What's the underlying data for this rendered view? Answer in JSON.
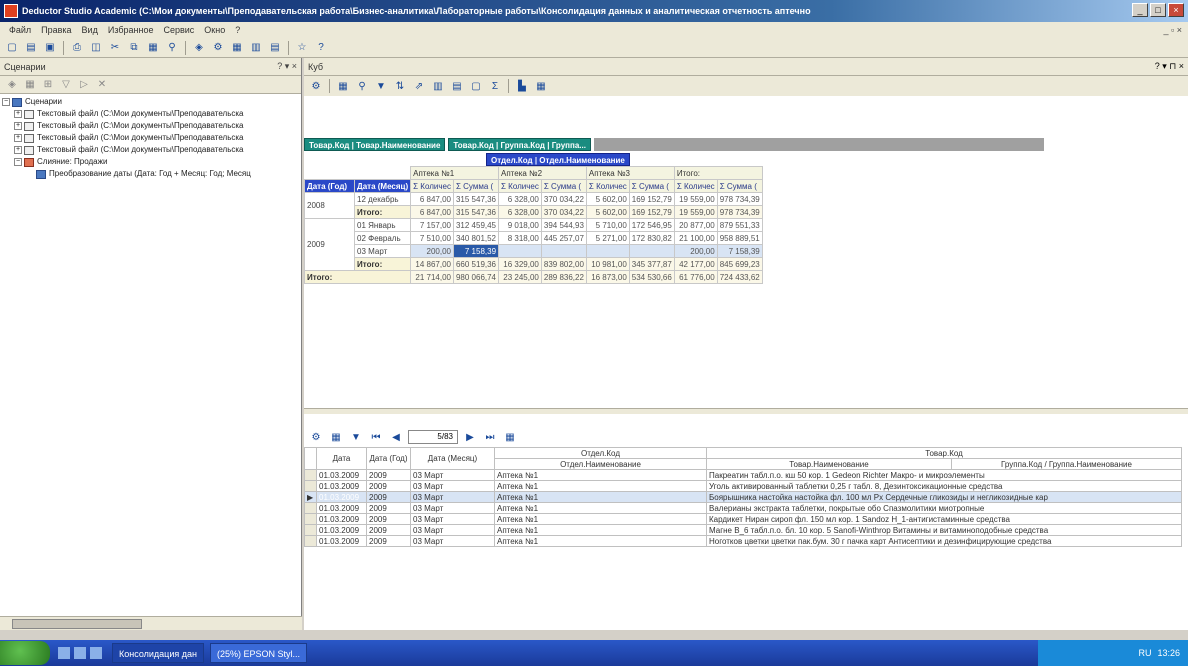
{
  "window": {
    "title": "Deductor Studio Academic (C:\\Мои документы\\Преподавательская работа\\Бизнес-аналитика\\Лабораторные работы\\Консолидация данных и аналитическая отчетность аптечно",
    "min": "_",
    "max": "□",
    "close": "×"
  },
  "menu": {
    "items": [
      "Файл",
      "Правка",
      "Вид",
      "Избранное",
      "Сервис",
      "Окно",
      "?"
    ],
    "mdi_controls": "_ ▫ ×"
  },
  "left_panel": {
    "title": "Сценарии",
    "controls": "? ▾ ×",
    "tree": [
      {
        "label": "Сценарии",
        "level": 0,
        "exp": "−",
        "icon": "folder"
      },
      {
        "label": "Текстовый файл (C:\\Мои документы\\Преподавательска",
        "level": 1,
        "exp": "+",
        "icon": "txt"
      },
      {
        "label": "Текстовый файл (C:\\Мои документы\\Преподавательска",
        "level": 1,
        "exp": "+",
        "icon": "txt"
      },
      {
        "label": "Текстовый файл (C:\\Мои документы\\Преподавательска",
        "level": 1,
        "exp": "+",
        "icon": "txt"
      },
      {
        "label": "Текстовый файл (C:\\Мои документы\\Преподавательска",
        "level": 1,
        "exp": "+",
        "icon": "txt"
      },
      {
        "label": "Слияние: Продажи",
        "level": 1,
        "exp": "−",
        "icon": "red"
      },
      {
        "label": "Преобразование даты (Дата: Год + Месяц: Год; Месяц",
        "level": 2,
        "exp": "",
        "icon": "folder"
      }
    ]
  },
  "right_panel": {
    "title": "Куб",
    "controls": "? ▾ ⊓ ×",
    "col_dims": [
      "Товар.Код | Товар.Наименование",
      "Товар.Код | Группа.Код | Группа..."
    ],
    "col_dim2": "Отдел.Код | Отдел.Наименование",
    "row_dims": [
      "Дата (Год)",
      "Дата (Месяц)"
    ],
    "departments": [
      "Аптека №1",
      "Аптека №2",
      "Аптека №3",
      "Итого:"
    ],
    "measures": [
      "Σ Количес",
      "Σ Сумма ("
    ],
    "rows": [
      {
        "year": "2008",
        "month": "12 декабрь",
        "vals": [
          "6 847,00",
          "315 547,36",
          "6 328,00",
          "370 034,22",
          "5 602,00",
          "169 152,79",
          "19 559,00",
          "978 734,39"
        ]
      },
      {
        "year": "",
        "month": "Итого:",
        "vals": [
          "6 847,00",
          "315 547,36",
          "6 328,00",
          "370 034,22",
          "5 602,00",
          "169 152,79",
          "19 559,00",
          "978 734,39"
        ],
        "total": true
      },
      {
        "year": "2009",
        "month": "01 Январь",
        "vals": [
          "7 157,00",
          "312 459,45",
          "9 018,00",
          "394 544,93",
          "5 710,00",
          "172 546,95",
          "20 877,00",
          "879 551,33"
        ]
      },
      {
        "year": "",
        "month": "02 Февраль",
        "vals": [
          "7 510,00",
          "340 801,52",
          "8 318,00",
          "445 257,07",
          "5 271,00",
          "172 830,82",
          "21 100,00",
          "958 889,51"
        ]
      },
      {
        "year": "",
        "month": "03 Март",
        "vals": [
          "200,00",
          "7 158,39",
          "",
          "",
          "",
          "",
          "200,00",
          "7 158,39"
        ],
        "selected": true
      },
      {
        "year": "",
        "month": "Итого:",
        "vals": [
          "14 867,00",
          "660 519,36",
          "16 329,00",
          "839 802,00",
          "10 981,00",
          "345 377,87",
          "42 177,00",
          "845 699,23"
        ],
        "total": true
      },
      {
        "year": "Итого:",
        "month": "",
        "vals": [
          "21 714,00",
          "980 066,74",
          "23 245,00",
          "289 836,22",
          "16 873,00",
          "534 530,66",
          "61 776,00",
          "724 433,62"
        ],
        "grand": true
      }
    ]
  },
  "detail": {
    "position": "5/83",
    "col_groups": {
      "otdel": "Отдел.Код",
      "tovar": "Товар.Код"
    },
    "headers": [
      "Дата",
      "Дата (Год)",
      "Дата (Месяц)",
      "Отдел.Наименование",
      "Товар.Наименование",
      "Группа.Код",
      "Группа.Наименование"
    ],
    "rows": [
      [
        "01.03.2009",
        "2009",
        "03 Март",
        "Аптека №1",
        "Пакреатин табл.п.о. кш 50 кор. 1 Gedeon Richter Макро- и микроэлементы"
      ],
      [
        "01.03.2009",
        "2009",
        "03 Март",
        "Аптека №1",
        "Уголь активированный таблетки 0,25 г табл. 8, Дезинтоксикационные средства"
      ],
      [
        "01.03.2009",
        "2009",
        "03 Март",
        "Аптека №1",
        "Боярышника настойка настойка фл. 100 мл Рх Сердечные гликозиды и негликозидные кар"
      ],
      [
        "01.03.2009",
        "2009",
        "03 Март",
        "Аптека №1",
        "Валерианы экстракта таблетки, покрытые обо Спазмолитики миотропные"
      ],
      [
        "01.03.2009",
        "2009",
        "03 Март",
        "Аптека №1",
        "Кардикет Ниран сироп фл. 150 мл кор. 1 Sandoz Н_1-антигистаминные средства"
      ],
      [
        "01.03.2009",
        "2009",
        "03 Март",
        "Аптека №1",
        "Магне В_6 табл.п.о. бл. 10 кор. 5 Sanofi-Winthrop Витамины и витаминоподобные средства"
      ],
      [
        "01.03.2009",
        "2009",
        "03 Март",
        "Аптека №1",
        "Ноготков цветки цветки пак.бум. 30 г пачка карт Антисептики и дезинфицирующие средства"
      ]
    ],
    "selected_index": 2
  },
  "taskbar": {
    "tasks": [
      "Консолидация дан",
      "(25%) EPSON Styl..."
    ],
    "clock": "13:26",
    "lang": "RU"
  }
}
